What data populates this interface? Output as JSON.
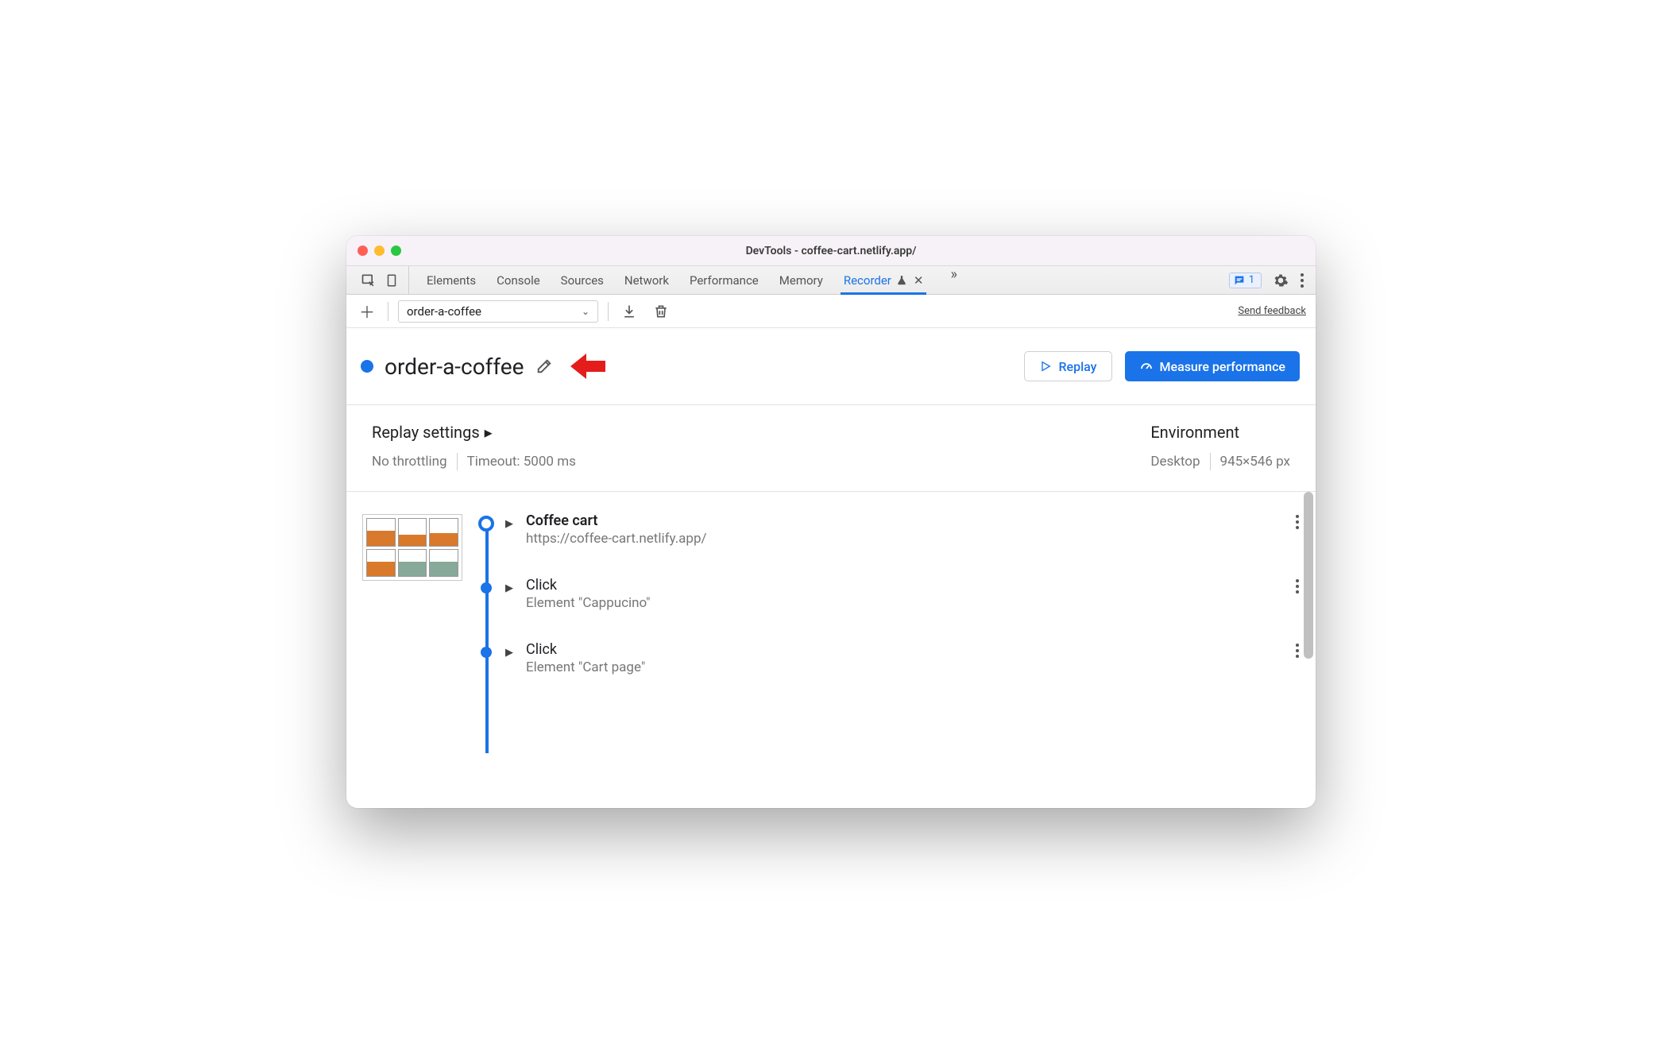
{
  "window": {
    "title": "DevTools - coffee-cart.netlify.app/"
  },
  "tabs": {
    "items": [
      "Elements",
      "Console",
      "Sources",
      "Network",
      "Performance",
      "Memory",
      "Recorder"
    ],
    "active_index": 6,
    "issues_count": "1"
  },
  "toolbar": {
    "recording_select": "order-a-coffee",
    "feedback": "Send feedback"
  },
  "header": {
    "title": "order-a-coffee",
    "replay_label": "Replay",
    "measure_label": "Measure performance"
  },
  "settings": {
    "replay_label": "Replay settings",
    "throttling": "No throttling",
    "timeout": "Timeout: 5000 ms",
    "env_label": "Environment",
    "device": "Desktop",
    "viewport": "945×546 px"
  },
  "steps": [
    {
      "title": "Coffee cart",
      "sub": "https://coffee-cart.netlify.app/",
      "big": true
    },
    {
      "title": "Click",
      "sub": "Element \"Cappucino\"",
      "big": false
    },
    {
      "title": "Click",
      "sub": "Element \"Cart page\"",
      "big": false
    }
  ]
}
